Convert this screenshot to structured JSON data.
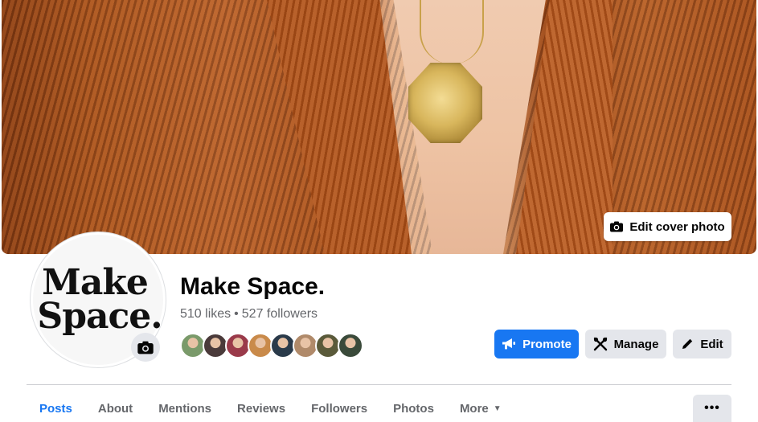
{
  "cover": {
    "edit_label": "Edit cover photo",
    "icon": "camera-icon"
  },
  "profile": {
    "logo_line1": "Make",
    "logo_line2": "Space.",
    "camera_icon": "camera-icon"
  },
  "page": {
    "name": "Make Space.",
    "likes": "510 likes",
    "separator": "•",
    "followers": "527 followers"
  },
  "follower_faces": [
    {
      "color": "#7a9a6a"
    },
    {
      "color": "#4a3a3a"
    },
    {
      "color": "#9a3a4a"
    },
    {
      "color": "#c98a4a"
    },
    {
      "color": "#2a3a4a"
    },
    {
      "color": "#b08a6a"
    },
    {
      "color": "#5a5a3a"
    },
    {
      "color": "#3a4a3a"
    }
  ],
  "actions": {
    "promote": "Promote",
    "manage": "Manage",
    "edit": "Edit"
  },
  "tabs": [
    {
      "label": "Posts",
      "active": true
    },
    {
      "label": "About"
    },
    {
      "label": "Mentions"
    },
    {
      "label": "Reviews"
    },
    {
      "label": "Followers"
    },
    {
      "label": "Photos"
    },
    {
      "label": "More"
    }
  ],
  "more_options": "•••",
  "colors": {
    "accent": "#1877f2",
    "secondary_button": "#e4e6eb",
    "muted_text": "#65676b"
  }
}
